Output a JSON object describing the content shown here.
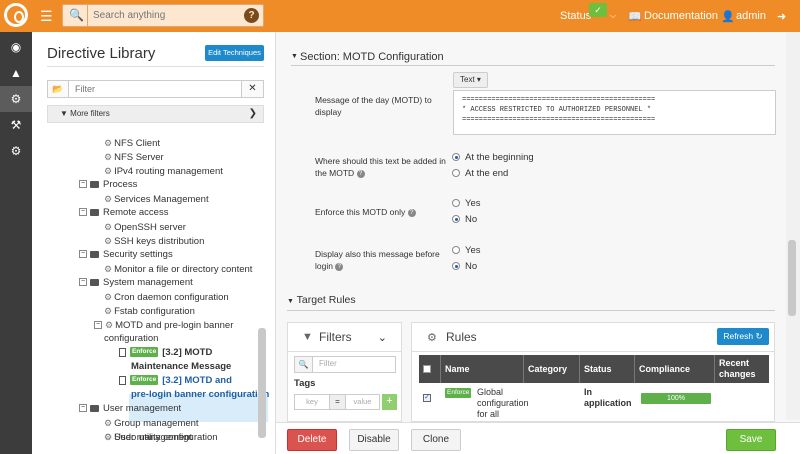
{
  "topbar": {
    "search_placeholder": "Search anything",
    "help_label": "?",
    "status_label": "Status",
    "documentation_label": "Documentation",
    "user_label": "admin"
  },
  "library": {
    "title": "Directive Library",
    "edit_techniques_label": "Edit Techniques",
    "filter_placeholder": "Filter",
    "more_filters_label": "More filters",
    "tree": [
      {
        "kind": "directive",
        "label": "NFS Client"
      },
      {
        "kind": "directive",
        "label": "NFS Server"
      },
      {
        "kind": "directive",
        "label": "IPv4 routing management"
      },
      {
        "kind": "category",
        "label": "Process"
      },
      {
        "kind": "directive",
        "label": "Services Management"
      },
      {
        "kind": "category",
        "label": "Remote access"
      },
      {
        "kind": "directive",
        "label": "OpenSSH server"
      },
      {
        "kind": "directive",
        "label": "SSH keys distribution"
      },
      {
        "kind": "category",
        "label": "Security settings"
      },
      {
        "kind": "directive",
        "label": "Monitor a file or directory content"
      },
      {
        "kind": "category",
        "label": "System management"
      },
      {
        "kind": "directive",
        "label": "Cron daemon configuration"
      },
      {
        "kind": "directive",
        "label": "Fstab configuration"
      },
      {
        "kind": "technique",
        "label_line1": "MOTD and pre-login banner",
        "label_line2": "configuration"
      },
      {
        "kind": "instance",
        "badge": "Enforce",
        "label_line1": "[3.2] MOTD",
        "label_line2": "Maintenance Message"
      },
      {
        "kind": "instance",
        "badge": "Enforce",
        "label_line1": "[3.2] MOTD and",
        "label_line2": "pre-login banner configuration"
      },
      {
        "kind": "category",
        "label": "User management"
      },
      {
        "kind": "directive",
        "label": "Group management"
      },
      {
        "kind": "directive",
        "label": "Sudo utility configuration"
      },
      {
        "kind": "directive",
        "label": "User management"
      }
    ]
  },
  "section": {
    "title": "Section: MOTD Configuration",
    "motd_label": "Message of the day (MOTD) to display",
    "text_dropdown": "Text",
    "motd_lines": [
      "==============================================",
      "* ACCESS RESTRICTED TO AUTHORIZED PERSONNEL *",
      "=============================================="
    ],
    "position_label": "Where should this text be added in the MOTD",
    "position_options": [
      "At the beginning",
      "At the end"
    ],
    "position_selected": "At the beginning",
    "enforce_label": "Enforce this MOTD only",
    "enforce_options": [
      "Yes",
      "No"
    ],
    "enforce_selected": "No",
    "display_label": "Display also this message before login",
    "display_options": [
      "Yes",
      "No"
    ],
    "display_selected": "No"
  },
  "target_rules": {
    "title": "Target Rules",
    "filters": {
      "title": "Filters",
      "search_placeholder": "Filter",
      "tags_label": "Tags",
      "key_placeholder": "key",
      "equals": "=",
      "value_placeholder": "value",
      "add_label": "+"
    },
    "rules": {
      "title": "Rules",
      "refresh_label": "Refresh",
      "columns": [
        "Name",
        "Category",
        "Status",
        "Compliance",
        "Recent changes"
      ],
      "rows": [
        {
          "badge": "Enforce",
          "name": "Global configuration for all nodes",
          "category": "",
          "status": "In application",
          "compliance": "100%"
        }
      ]
    }
  },
  "actions": {
    "delete_label": "Delete",
    "disable_label": "Disable",
    "clone_label": "Clone",
    "save_label": "Save"
  },
  "colors": {
    "topbar": "#f08c28",
    "leftnav": "#3c3c3c",
    "primary": "#1f8acb",
    "success": "#6fbf3e",
    "danger": "#d9534f"
  }
}
